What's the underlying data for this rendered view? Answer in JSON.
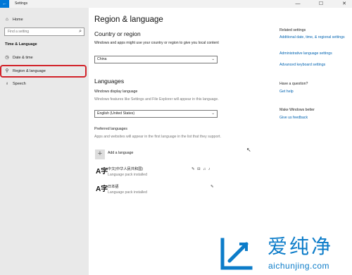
{
  "window": {
    "title": "Settings"
  },
  "titlebar": {
    "back": "←",
    "minimize": "—",
    "maximize": "☐",
    "close": "✕"
  },
  "sidebar": {
    "home": {
      "icon": "home-icon",
      "label": "Home"
    },
    "search": {
      "placeholder": "Find a setting",
      "icon": "search-icon"
    },
    "section_title": "Time & Language",
    "items": [
      {
        "icon": "calendar-clock-icon",
        "label": "Date & time"
      },
      {
        "icon": "language-icon",
        "label": "Region & language",
        "selected": true
      },
      {
        "icon": "microphone-icon",
        "label": "Speech"
      }
    ]
  },
  "main": {
    "page_title": "Region & language",
    "country": {
      "heading": "Country or region",
      "description": "Windows and apps might use your country or region to give you local content",
      "value": "China"
    },
    "languages": {
      "heading": "Languages",
      "display_label": "Windows display language",
      "display_description": "Windows features like Settings and File Explorer will appear in this language.",
      "display_value": "English (United States)",
      "preferred_label": "Preferred languages",
      "preferred_description": "Apps and websites will appear in the first language in the list that they support.",
      "add_label": "Add a language",
      "list": [
        {
          "name": "中文(中华人民共和国)",
          "status": "Language pack installed",
          "features": "✎ ⊟ ♫ ♪"
        },
        {
          "name": "日本語",
          "status": "Language pack installed",
          "features": "✎"
        }
      ]
    }
  },
  "related": {
    "heading": "Related settings",
    "links": [
      "Additional date, time, & regional settings",
      "Administrative language settings",
      "Advanced keyboard settings"
    ]
  },
  "help": {
    "heading": "Have a question?",
    "link": "Get help"
  },
  "improve": {
    "heading": "Make Windows better",
    "link": "Give us feedback"
  },
  "watermark": {
    "text": "爱纯净",
    "url": "aichunjing.com"
  },
  "colors": {
    "accent": "#0078d7",
    "link": "#0063b1",
    "highlight": "#d2232a",
    "sidebar": "#e9e9e9",
    "watermark": "#0c7cc9"
  }
}
